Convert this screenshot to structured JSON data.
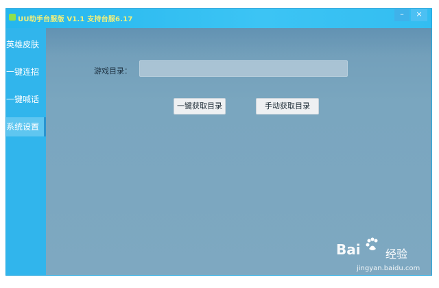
{
  "window": {
    "title": "UU助手台服版 V1.1 支持台服6.17",
    "minimize_glyph": "–",
    "close_glyph": "×"
  },
  "sidebar": {
    "items": [
      {
        "label": "英雄皮肤",
        "active": false
      },
      {
        "label": "一键连招",
        "active": false
      },
      {
        "label": "一键喊话",
        "active": false
      },
      {
        "label": "系统设置",
        "active": true
      }
    ]
  },
  "main": {
    "game_dir_label": "游戏目录：",
    "game_dir_value": "",
    "auto_get_button": "一键获取目录",
    "manual_get_button": "手动获取目录"
  },
  "watermark": {
    "brand": "Bai",
    "brand_suffix": "经验",
    "url": "jingyan.baidu.com"
  },
  "colors": {
    "titlebar": "#33bdf1",
    "title_text": "#f2f07a",
    "sidebar": "#31b5ec",
    "main_bg": "#7aa6bf",
    "button_bg": "#eef0f2"
  }
}
